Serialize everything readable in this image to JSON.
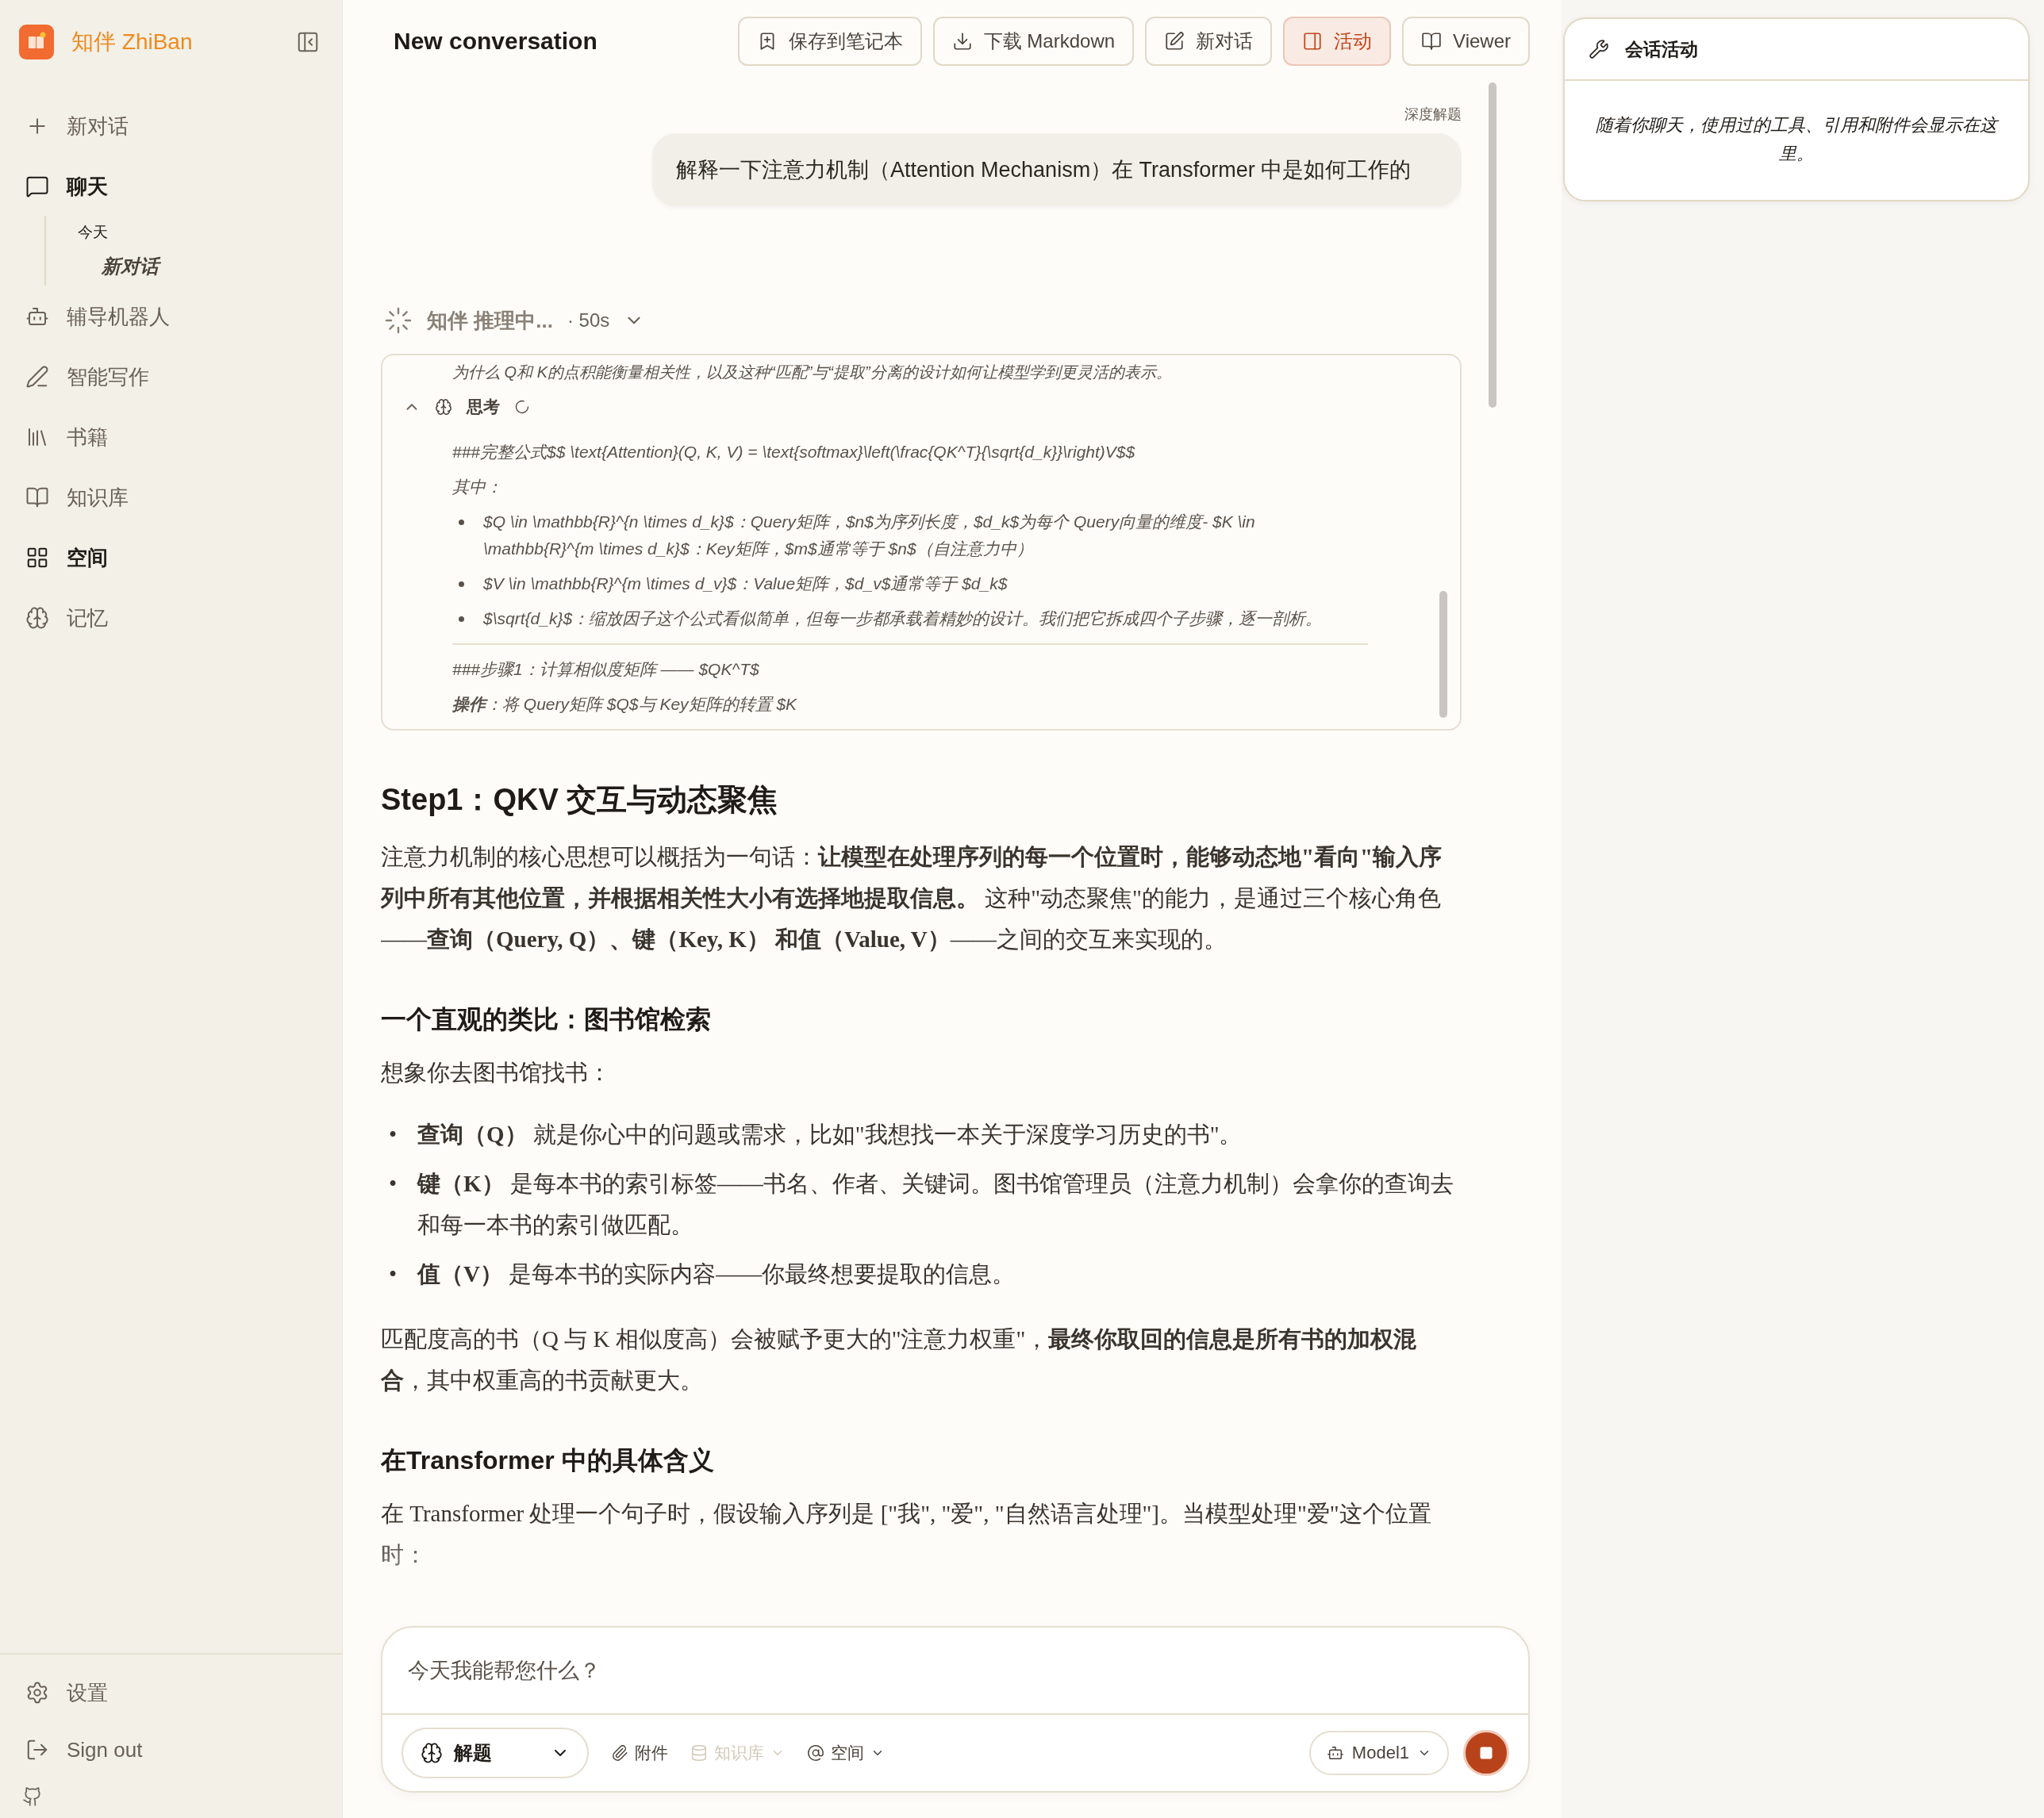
{
  "app": {
    "name": "知伴 ZhiBan"
  },
  "sidebar": {
    "nav": [
      {
        "label": "新对话",
        "selected": false
      },
      {
        "label": "聊天",
        "selected": true,
        "history": {
          "group": "今天",
          "items": [
            {
              "label": "新对话",
              "selected": true
            }
          ]
        }
      },
      {
        "label": "辅导机器人",
        "selected": false
      },
      {
        "label": "智能写作",
        "selected": false
      },
      {
        "label": "书籍",
        "selected": false
      },
      {
        "label": "知识库",
        "selected": false
      },
      {
        "label": "空间",
        "selected": true
      },
      {
        "label": "记忆",
        "selected": false
      }
    ],
    "footer": [
      {
        "label": "设置"
      },
      {
        "label": "Sign out"
      }
    ]
  },
  "header": {
    "title": "New conversation",
    "buttons": [
      {
        "label": "保存到笔记本",
        "selected": false
      },
      {
        "label": "下载 Markdown",
        "selected": false
      },
      {
        "label": "新对话",
        "selected": false
      },
      {
        "label": "活动",
        "selected": true
      },
      {
        "label": "Viewer",
        "selected": false
      }
    ]
  },
  "message": {
    "tag": "深度解题",
    "text": "解释一下注意力机制（Attention Mechanism）在 Transformer 中是如何工作的"
  },
  "reasoning": {
    "label": "知伴 推理中...",
    "elapsed": "· 50s",
    "expanded": false,
    "intro": "为什么 Q和 K的点积能衡量相关性，以及这种“匹配”与“提取”分离的设计如何让模型学到更灵活的表示。",
    "thinking": {
      "label": "思考",
      "expanded": true,
      "lines": [
        {
          "kind": "text",
          "text": "###完整公式$$ \\text{Attention}(Q, K, V) = \\text{softmax}\\left(\\frac{QK^T}{\\sqrt{d_k}}\\right)V$$"
        },
        {
          "kind": "text",
          "text": "其中："
        },
        {
          "kind": "bullet",
          "text": "$Q \\in \\mathbb{R}^{n \\times d_k}$：Query矩阵，$n$为序列长度，$d_k$为每个 Query向量的维度- $K \\in \\mathbb{R}^{m \\times d_k}$：Key矩阵，$m$通常等于 $n$（自注意力中）"
        },
        {
          "kind": "bullet",
          "text": "$V \\in \\mathbb{R}^{m \\times d_v}$：Value矩阵，$d_v$通常等于 $d_k$"
        },
        {
          "kind": "bullet",
          "text": "$\\sqrt{d_k}$：缩放因子这个公式看似简单，但每一步都承载着精妙的设计。我们把它拆成四个子步骤，逐一剖析。"
        },
        {
          "kind": "divider"
        },
        {
          "kind": "text",
          "text": "###步骤1：计算相似度矩阵 —— $QK^T$"
        },
        {
          "kind": "text",
          "text": "**操作**：将 Query矩阵 $Q$与 Key矩阵的转置 $K"
        }
      ]
    }
  },
  "article": [
    {
      "kind": "h2",
      "text": "Step1：QKV 交互与动态聚焦"
    },
    {
      "kind": "p",
      "text": "注意力机制的核心思想可以概括为一句话：**让模型在处理序列的每一个位置时，能够动态地\"看向\"输入序列中所有其他位置，并根据相关性大小有选择地提取信息。** 这种\"动态聚焦\"的能力，是通过三个核心角色——**查询（Query, Q）、键（Key, K） 和值（Value, V）**——之间的交互来实现的。"
    },
    {
      "kind": "h3",
      "text": "一个直观的类比：图书馆检索"
    },
    {
      "kind": "p",
      "text": "想象你去图书馆找书："
    },
    {
      "kind": "list",
      "items": [
        {
          "marker": "•",
          "text": "**查询（Q）** 就是你心中的问题或需求，比如\"我想找一本关于深度学习历史的书\"。"
        },
        {
          "marker": "•",
          "text": "**键（K）** 是每本书的索引标签——书名、作者、关键词。图书馆管理员（注意力机制）会拿你的查询去和每一本书的索引做匹配。"
        },
        {
          "marker": "•",
          "text": "**值（V）** 是每本书的实际内容——你最终想要提取的信息。"
        }
      ]
    },
    {
      "kind": "p",
      "text": "匹配度高的书（Q 与 K 相似度高）会被赋予更大的\"注意力权重\"，**最终你取回的信息是所有书的加权混合**，其中权重高的书贡献更大。"
    },
    {
      "kind": "h3",
      "text": "在Transformer 中的具体含义"
    },
    {
      "kind": "p",
      "text": "在 Transformer 处理一个句子时，假设输入序列是 [\"我\", \"爱\", \"自然语言处理\"]。当模型处理\"爱\"这个位置时："
    }
  ],
  "composer": {
    "placeholder": "今天我能帮您什么？",
    "mode": "解题",
    "tools": [
      {
        "label": "附件",
        "disabled": false,
        "dropdown": false
      },
      {
        "label": "知识库",
        "disabled": true,
        "dropdown": true
      },
      {
        "label": "空间",
        "disabled": false,
        "dropdown": true
      }
    ],
    "model": "Model1"
  },
  "activity": {
    "title": "会话活动",
    "empty": "随着你聊天，使用过的工具、引用和附件会显示在这里。"
  }
}
